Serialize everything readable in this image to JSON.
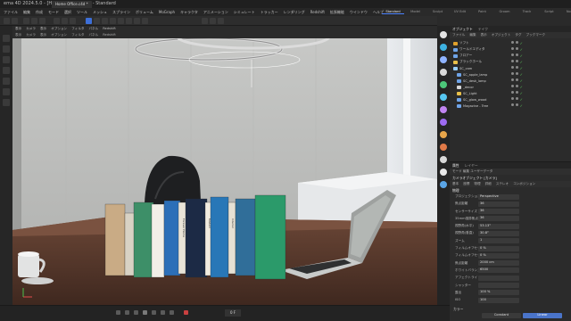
{
  "window": {
    "title": "ema 4D 2024.5.0 - [Home Office.c4d *] - Standard"
  },
  "doc_tabs": [
    "Home Office.c4d *"
  ],
  "layouts": [
    "Standard",
    "Model",
    "Sculpt",
    "UV Edit",
    "Paint",
    "Groom",
    "Track",
    "Script",
    "Nodes"
  ],
  "menu": [
    "ファイル",
    "編集",
    "作成",
    "モード",
    "選択",
    "ツール",
    "メッシュ",
    "スプライン",
    "ボリューム",
    "MoGraph",
    "キャラクタ",
    "アニメーション",
    "シミュレート",
    "トラッカー",
    "レンダリング",
    "Redshift",
    "拡張機能",
    "ウインドウ",
    "ヘルプ"
  ],
  "viewport": {
    "header": [
      "表示",
      "カメラ",
      "表示",
      "オプション",
      "フィルタ",
      "パネル",
      "Redshift"
    ],
    "submenu": [
      "表示",
      "カメラ",
      "表示",
      "オプション",
      "フィルタ",
      "パネル",
      "Redshift"
    ],
    "books": [
      {
        "color": "#c9ab85",
        "title": ""
      },
      {
        "color": "#d8d2c4",
        "title": ""
      },
      {
        "color": "#3d8f68",
        "title": ""
      },
      {
        "color": "#f2efe8",
        "title": ""
      },
      {
        "color": "#2c6fb8",
        "title": ""
      },
      {
        "color": "#e9e4d8",
        "title": "Forever Home"
      },
      {
        "color": "#1c2a45",
        "title": ""
      },
      {
        "color": "#f1ece0",
        "title": "Modern"
      },
      {
        "color": "#2877b7",
        "title": ""
      },
      {
        "color": "#e6e1d4",
        "title": "Interior"
      },
      {
        "color": "#306e99",
        "title": ""
      },
      {
        "color": "#2b9a6a",
        "title": ""
      }
    ]
  },
  "object_manager": {
    "tabs": [
      "オブジェクト",
      "テイク"
    ],
    "menu": [
      "ファイル",
      "編集",
      "表示",
      "オブジェクト",
      "タグ",
      "ブックマーク"
    ],
    "objects": [
      {
        "name": "ソフト",
        "icon_color": "#e0a12c"
      },
      {
        "name": "ワールドエディタ",
        "icon_color": "#6fa4e8"
      },
      {
        "name": "フロアー",
        "icon_color": "#6fa4e8"
      },
      {
        "name": "ブラックホール",
        "icon_color": "#e8c04a"
      },
      {
        "name": "SC_cam",
        "icon_color": "#9ad0ff"
      },
      {
        "name": "SC_apple_lamp",
        "icon_color": "#6fa4e8"
      },
      {
        "name": "SC_desk_lamp",
        "icon_color": "#6fa4e8"
      },
      {
        "name": "_decor",
        "icon_color": "#d7d7d7"
      },
      {
        "name": "SC_Light",
        "icon_color": "#e8c04a"
      },
      {
        "name": "SC_glow_wood",
        "icon_color": "#6fa4e8"
      },
      {
        "name": "Magazine - Tree",
        "icon_color": "#6fa4e8"
      }
    ]
  },
  "attribute_manager": {
    "tabs": [
      "属性",
      "レイヤー"
    ],
    "mode_label": "モード 編集 ユーザーデータ",
    "object_title": "カメラオブジェクト [カメラ]",
    "subtabs": [
      "基本",
      "座標",
      "物理",
      "詳細",
      "ステレオ",
      "コンポジション"
    ],
    "section_label": "物理",
    "rows": [
      {
        "label": "プロジェクション",
        "value": "Perspective"
      },
      {
        "label": "焦点距離",
        "value": "36"
      },
      {
        "label": "センサーサイズ",
        "value": "36"
      },
      {
        "label": "35mm換算焦点距離",
        "value": "36"
      },
      {
        "label": "視野角(水平)",
        "value": "53.13°"
      },
      {
        "label": "視野角(垂直)",
        "value": "30.8°"
      },
      {
        "label": "ズーム",
        "value": "1"
      },
      {
        "label": "フィルムオフセットX",
        "value": "0 %"
      },
      {
        "label": "フィルムオフセットY",
        "value": "0 %"
      },
      {
        "label": "焦点距離",
        "value": "2000 cm"
      },
      {
        "label": "ホワイトバランス(K)",
        "value": "6500"
      },
      {
        "label": "アフェクトライト",
        "value": ""
      },
      {
        "label": "シャッター",
        "value": ""
      },
      {
        "label": "露出",
        "value": "100 %"
      },
      {
        "label": "ISO",
        "value": "100"
      }
    ],
    "seg_row": [
      "Linear",
      "Logarithmic"
    ]
  },
  "timeline": {
    "current_frame": "0 F"
  },
  "anim_panel": {
    "label": "カラー",
    "values": [
      "Constant",
      "Linear"
    ]
  }
}
